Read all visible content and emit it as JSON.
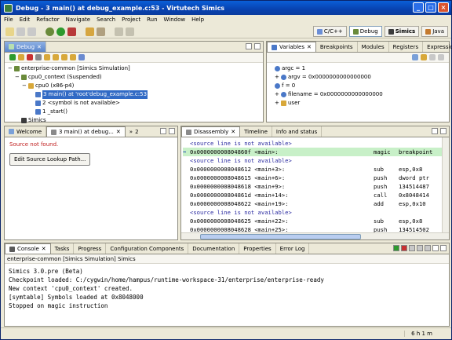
{
  "window": {
    "title": "Debug - 3 main() at debug_example.c:53 - Virtutech Simics"
  },
  "menu": [
    "File",
    "Edit",
    "Refactor",
    "Navigate",
    "Search",
    "Project",
    "Run",
    "Window",
    "Help"
  ],
  "perspectives": [
    {
      "label": "C/C++",
      "active": false
    },
    {
      "label": "Debug",
      "active": true
    },
    {
      "label": "Simics",
      "active": false
    },
    {
      "label": "Java",
      "active": false
    }
  ],
  "debug_view": {
    "tab": "Debug",
    "tree": [
      {
        "label": "enterprise-common [Simics Simulation]",
        "indent": 0
      },
      {
        "label": "cpu0_context (Suspended)",
        "indent": 1
      },
      {
        "label": "cpu0 (x86-p4)",
        "indent": 2
      },
      {
        "label": "3 main() at 'root'debug_example.c:53",
        "indent": 3,
        "selected": true
      },
      {
        "label": "2 <symbol is not available>",
        "indent": 3
      },
      {
        "label": "1 _start()",
        "indent": 3
      },
      {
        "label": "Simics",
        "indent": 1
      }
    ]
  },
  "variables_view": {
    "tabs": [
      "Variables",
      "Breakpoints",
      "Modules",
      "Registers",
      "Expressions"
    ],
    "rows": [
      "argc = 1",
      "argv = 0x0000000000000000",
      "f = 0",
      "filename = 0x0000000000000000",
      "user"
    ]
  },
  "editor_view": {
    "tabs": [
      "Welcome",
      "3 main() at debug...",
      "2"
    ],
    "message": "Source not found.",
    "button": "Edit Source Lookup Path..."
  },
  "disassembly_view": {
    "tabs": [
      "Disassembly",
      "Timeline",
      "Info and status"
    ],
    "lines": [
      {
        "text": "<source line is not available>",
        "type": "src"
      },
      {
        "text": "0x000000000804860f <main>:",
        "op": "magic",
        "args": "breakpoint",
        "type": "current"
      },
      {
        "text": "<source line is not available>",
        "type": "src"
      },
      {
        "text": "0x0000000008048612 <main+3>:",
        "op": "sub",
        "args": "esp,0x8"
      },
      {
        "text": "0x0000000008048615 <main+6>:",
        "op": "push",
        "args": "dword ptr"
      },
      {
        "text": "0x0000000008048618 <main+9>:",
        "op": "push",
        "args": "134514487"
      },
      {
        "text": "0x000000000804861d <main+14>:",
        "op": "call",
        "args": "0x8048414"
      },
      {
        "text": "0x0000000008048622 <main+19>:",
        "op": "add",
        "args": "esp,0x10"
      },
      {
        "text": "<source line is not available>",
        "type": "src"
      },
      {
        "text": "0x0000000008048625 <main+22>:",
        "op": "sub",
        "args": "esp,0x8"
      },
      {
        "text": "0x0000000008048628 <main+25>:",
        "op": "push",
        "args": "134514502"
      }
    ]
  },
  "console_view": {
    "tabs": [
      "Console",
      "Tasks",
      "Progress",
      "Configuration Components",
      "Documentation",
      "Properties",
      "Error Log"
    ],
    "subtitle": "enterprise-common [Simics Simulation] Simics",
    "lines": [
      "Simics 3.0.pre (Beta)",
      "Checkpoint loaded: C:/cygwin/home/hampus/runtime-workspace-31/enterprise/enterprise-ready",
      "New context 'cpu0_context' created.",
      "[symtable] Symbols loaded at 0x8048000",
      "Stopped on magic instruction"
    ]
  },
  "status": {
    "time": "6 h 1 m"
  }
}
